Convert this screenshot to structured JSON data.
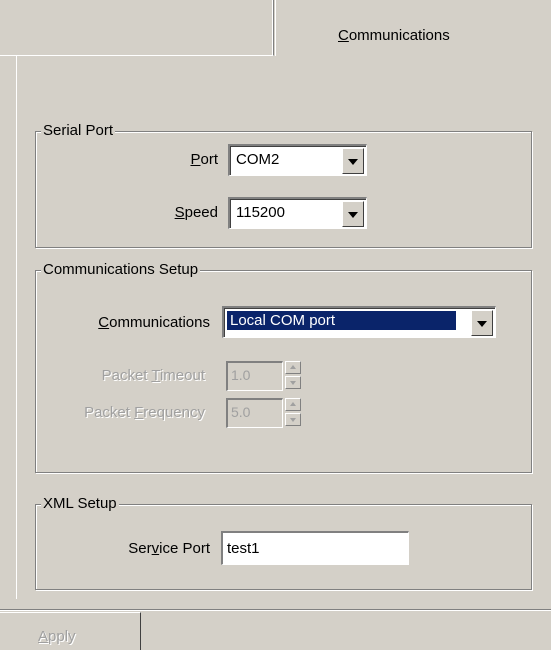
{
  "tabs": {
    "left_label": "",
    "active_label": "Communications"
  },
  "serial_port": {
    "legend": "Serial Port",
    "port_label": "Port",
    "port_value": "COM2",
    "speed_label": "Speed",
    "speed_value": "115200"
  },
  "comm_setup": {
    "legend": "Communications Setup",
    "comm_label": "Communications",
    "comm_value": "Local COM port",
    "packet_timeout_label": "Packet Timeout",
    "packet_timeout_value": "1.0",
    "packet_frequency_label": "Packet Frequency",
    "packet_frequency_value": "5.0"
  },
  "xml_setup": {
    "legend": "XML Setup",
    "service_port_label": "Service Port",
    "service_port_value": "test1"
  },
  "footer": {
    "apply_label": "Apply"
  },
  "colors": {
    "face": "#d4d0c8",
    "selection": "#0a246a",
    "disabled_text": "#a0a0a0"
  }
}
